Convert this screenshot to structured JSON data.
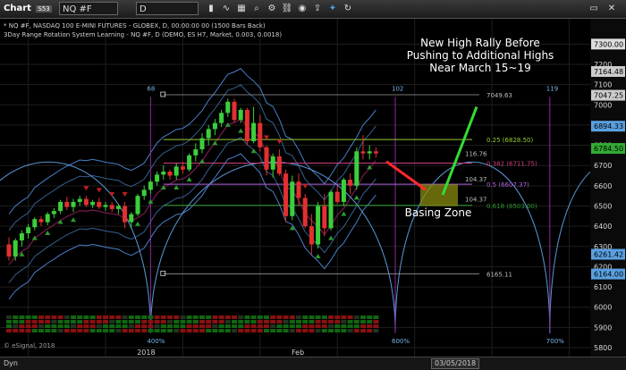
{
  "toolbar": {
    "app_label": "Chart",
    "app_badge": "S53",
    "symbol_value": "NQ #F",
    "interval_value": "D"
  },
  "footer": {
    "dyn_label": "Dyn",
    "cursor_date": "03/05/2018"
  },
  "chart_data": {
    "type": "candlestick",
    "title": "* NQ #F, NASDAQ 100 E-MINI FUTURES - GLOBEX, D, 00:00:00 00 (1500 Bars Back)",
    "subtitle": "3Day Range Rotation System Learning - NQ #F, D (DEMO, ES H7, Market, 0.003, 0.0018)",
    "copyright": "© eSignal, 2018",
    "ylim": [
      5800,
      7350
    ],
    "y_ticks": [
      5800,
      5900,
      6000,
      6100,
      6200,
      6300,
      6400,
      6500,
      6600,
      6700,
      6800,
      6900,
      7000,
      7100,
      7200,
      7300
    ],
    "x_labels": [
      {
        "label": "2018",
        "index": 21
      },
      {
        "label": "Feb",
        "index": 45
      }
    ],
    "price_tags": [
      {
        "label": "7300.00",
        "value": 7300,
        "color": "#dddddd"
      },
      {
        "label": "7164.48",
        "value": 7164.48,
        "color": "#cccccc"
      },
      {
        "label": "7047.25",
        "value": 7047.25,
        "color": "#cccccc"
      },
      {
        "label": "6894.33",
        "value": 6894.33,
        "color": "#5aa0e0"
      },
      {
        "label": "6784.50",
        "value": 6784.5,
        "color": "#33aa33"
      },
      {
        "label": "6261.42",
        "value": 6261.42,
        "color": "#5aa0e0"
      },
      {
        "label": "6164.00",
        "value": 6164.0,
        "color": "#5aa0e0"
      }
    ],
    "fib_levels": [
      {
        "label": "0.25 (6828.50)",
        "value": 6828.5,
        "color": "#9acd32"
      },
      {
        "label": "0.382 (6711.75)",
        "value": 6711.75,
        "color": "#d04080"
      },
      {
        "label": "0.5 (6607.37)",
        "value": 6607.37,
        "color": "#b060e0"
      },
      {
        "label": "0.618 (6503.00)",
        "value": 6503.0,
        "color": "#2e9a2e"
      }
    ],
    "ref_levels": [
      {
        "label": "7049.63",
        "value": 7049.63
      },
      {
        "label": "6165.11",
        "value": 6165.11
      }
    ],
    "side_labels": [
      {
        "label": "116.76",
        "value": 6760
      },
      {
        "label": "104.37",
        "value": 6635
      },
      {
        "label": "104.37",
        "value": 6535
      }
    ],
    "cycle_labels": [
      {
        "label": "68",
        "index": 22
      },
      {
        "label": "102",
        "index": 60
      },
      {
        "label": "119",
        "index": 84
      },
      {
        "label": "400%",
        "index": 22
      },
      {
        "label": "600%",
        "index": 60
      },
      {
        "label": "700%",
        "index": 84
      }
    ],
    "candles": [
      [
        6310,
        6345,
        6230,
        6250
      ],
      [
        6250,
        6340,
        6230,
        6330
      ],
      [
        6330,
        6380,
        6300,
        6365
      ],
      [
        6365,
        6410,
        6340,
        6395
      ],
      [
        6395,
        6445,
        6380,
        6435
      ],
      [
        6435,
        6450,
        6400,
        6420
      ],
      [
        6420,
        6470,
        6405,
        6460
      ],
      [
        6460,
        6490,
        6440,
        6475
      ],
      [
        6475,
        6530,
        6460,
        6520
      ],
      [
        6520,
        6545,
        6480,
        6495
      ],
      [
        6495,
        6535,
        6470,
        6520
      ],
      [
        6520,
        6550,
        6500,
        6535
      ],
      [
        6535,
        6550,
        6495,
        6505
      ],
      [
        6505,
        6530,
        6490,
        6520
      ],
      [
        6520,
        6540,
        6485,
        6495
      ],
      [
        6495,
        6520,
        6475,
        6505
      ],
      [
        6505,
        6520,
        6470,
        6485
      ],
      [
        6485,
        6510,
        6460,
        6500
      ],
      [
        6500,
        6520,
        6390,
        6420
      ],
      [
        6420,
        6470,
        6390,
        6460
      ],
      [
        6460,
        6560,
        6450,
        6550
      ],
      [
        6550,
        6600,
        6530,
        6580
      ],
      [
        6580,
        6630,
        6560,
        6620
      ],
      [
        6620,
        6670,
        6600,
        6655
      ],
      [
        6655,
        6700,
        6630,
        6670
      ],
      [
        6670,
        6680,
        6630,
        6650
      ],
      [
        6650,
        6710,
        6630,
        6695
      ],
      [
        6695,
        6720,
        6660,
        6680
      ],
      [
        6680,
        6760,
        6670,
        6750
      ],
      [
        6750,
        6810,
        6720,
        6780
      ],
      [
        6780,
        6860,
        6760,
        6835
      ],
      [
        6835,
        6900,
        6800,
        6880
      ],
      [
        6880,
        6930,
        6850,
        6910
      ],
      [
        6910,
        6975,
        6890,
        6960
      ],
      [
        6960,
        7030,
        6940,
        7015
      ],
      [
        7015,
        7030,
        6910,
        6925
      ],
      [
        6925,
        6985,
        6910,
        6975
      ],
      [
        6975,
        6985,
        6800,
        6820
      ],
      [
        6820,
        6990,
        6810,
        6910
      ],
      [
        6910,
        6950,
        6770,
        6790
      ],
      [
        6790,
        6800,
        6650,
        6680
      ],
      [
        6680,
        6760,
        6640,
        6745
      ],
      [
        6745,
        6780,
        6650,
        6660
      ],
      [
        6660,
        6680,
        6420,
        6450
      ],
      [
        6450,
        6650,
        6430,
        6620
      ],
      [
        6620,
        6660,
        6500,
        6540
      ],
      [
        6540,
        6560,
        6390,
        6400
      ],
      [
        6400,
        6460,
        6260,
        6310
      ],
      [
        6310,
        6520,
        6290,
        6500
      ],
      [
        6500,
        6560,
        6350,
        6390
      ],
      [
        6390,
        6580,
        6380,
        6570
      ],
      [
        6570,
        6600,
        6510,
        6520
      ],
      [
        6520,
        6640,
        6500,
        6630
      ],
      [
        6630,
        6660,
        6560,
        6600
      ],
      [
        6600,
        6790,
        6580,
        6770
      ],
      [
        6770,
        6850,
        6730,
        6760
      ],
      [
        6760,
        6800,
        6730,
        6770
      ],
      [
        6770,
        6790,
        6740,
        6760
      ]
    ],
    "annotations": {
      "headline": [
        "New High Rally Before",
        "Pushing to Additional Highs",
        "Near March 15~19"
      ],
      "zone_label": "Basing Zone"
    }
  }
}
